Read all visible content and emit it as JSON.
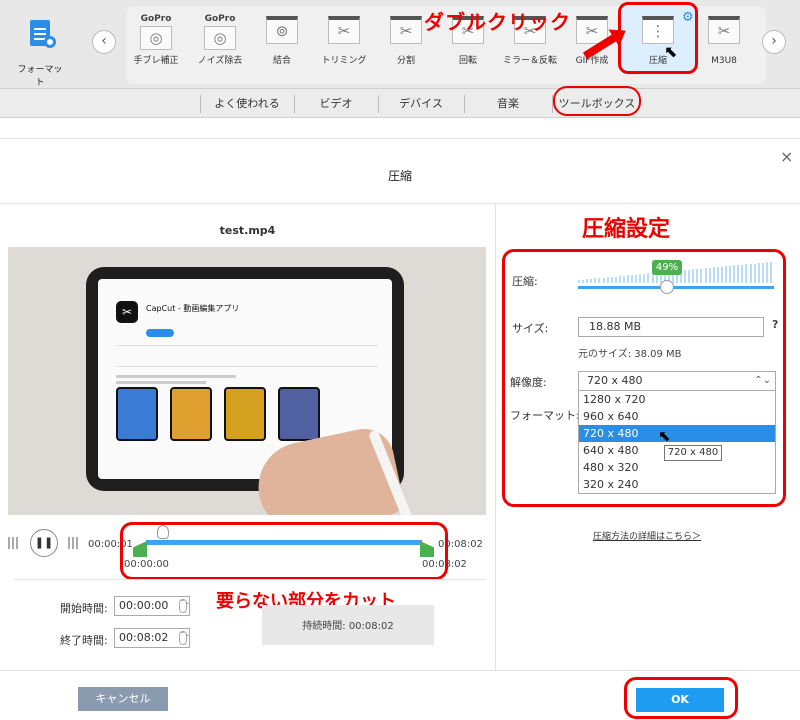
{
  "toolbar": {
    "format_label": "フォーマット",
    "prev_arrow": "‹",
    "next_arrow": "›",
    "tools": [
      {
        "label": "手ブレ補正",
        "brand": "GoPro",
        "icon": "gopro-icon"
      },
      {
        "label": "ノイズ除去",
        "brand": "GoPro",
        "icon": "gopro-icon"
      },
      {
        "label": "結合",
        "brand": "",
        "icon": "merge-icon"
      },
      {
        "label": "トリミング",
        "brand": "",
        "icon": "trim-icon"
      },
      {
        "label": "分割",
        "brand": "",
        "icon": "split-icon"
      },
      {
        "label": "回転",
        "brand": "",
        "icon": "rotate-icon"
      },
      {
        "label": "ミラー＆反転",
        "brand": "",
        "icon": "mirror-icon"
      },
      {
        "label": "GIF作成",
        "brand": "",
        "icon": "gif-icon"
      },
      {
        "label": "圧縮",
        "brand": "",
        "icon": "compress-icon",
        "selected": true
      },
      {
        "label": "M3U8",
        "brand": "",
        "icon": "m3u8-icon"
      }
    ]
  },
  "annotations": {
    "double_click": "ダブルクリック",
    "compress_settings": "圧縮設定",
    "cut_unneeded": "要らない部分をカット"
  },
  "categories": [
    "よく使われる",
    "ビデオ",
    "デバイス",
    "音楽",
    "ツールボックス"
  ],
  "dialog": {
    "title": "圧縮",
    "close": "×",
    "filename": "test.mp4",
    "preview_app": {
      "title": "CapCut - 動画編集アプリ",
      "logo": "✂"
    },
    "playback": {
      "pause_symbol": "❚❚",
      "time_start": "00:00:01",
      "time_end": "00:08:02",
      "trim_start": "00:00:00",
      "trim_end": "00:08:02"
    },
    "times": {
      "start_label": "開始時間:",
      "start_value": "00:00:00",
      "end_label": "終了時間:",
      "end_value": "00:08:02",
      "duration_label": "持続時間:",
      "duration_value": "00:08:02"
    },
    "settings": {
      "compress_label": "圧縮:",
      "percent": "49%",
      "percent_value": 49,
      "size_label": "サイズ:",
      "size_value": "18.88  MB",
      "help": "?",
      "original_size": "元のサイズ: 38.09 MB",
      "resolution_label": "解像度:",
      "resolution_value": "720 x 480",
      "format_label": "フォーマット:",
      "resolution_options": [
        "1280 x 720",
        "960 x 640",
        "720 x 480",
        "640 x 480",
        "480 x 320",
        "320 x 240"
      ],
      "selected_index": 2,
      "tooltip": "720 x 480",
      "more_link": "圧縮方法の詳細はこちら＞"
    },
    "buttons": {
      "cancel": "キャンセル",
      "ok": "OK"
    }
  },
  "colors": {
    "accent": "#1e9cf2",
    "annotation_red": "#e00000",
    "badge_green": "#4caf50"
  }
}
